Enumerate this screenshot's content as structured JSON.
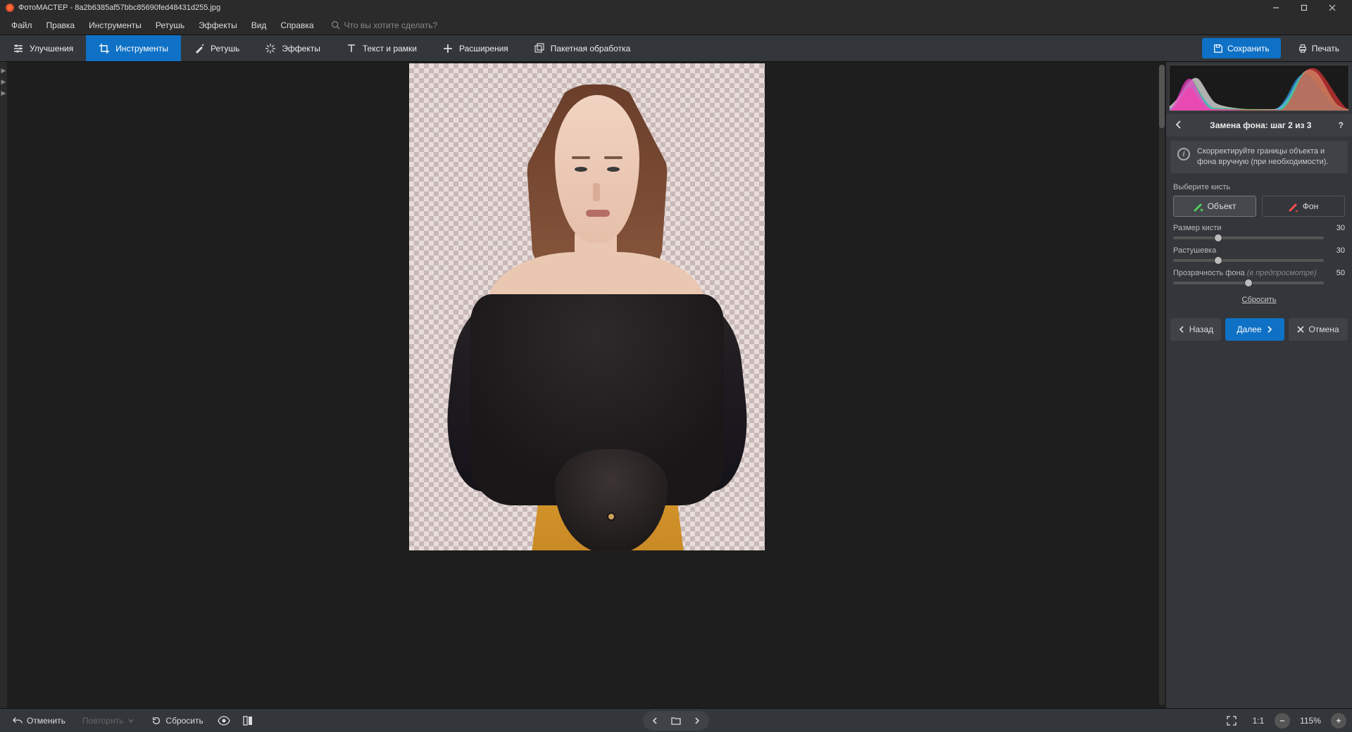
{
  "titlebar": {
    "app_name": "ФотоМАСТЕР",
    "file_name": "8a2b6385af57bbc85690fed48431d255.jpg"
  },
  "menubar": {
    "items": [
      "Файл",
      "Правка",
      "Инструменты",
      "Ретушь",
      "Эффекты",
      "Вид",
      "Справка"
    ],
    "search_placeholder": "Что вы хотите сделать?"
  },
  "toolbar": {
    "tabs": [
      {
        "label": "Улучшения",
        "icon": "sliders"
      },
      {
        "label": "Инструменты",
        "icon": "crop",
        "active": true
      },
      {
        "label": "Ретушь",
        "icon": "retouch"
      },
      {
        "label": "Эффекты",
        "icon": "sparkle"
      },
      {
        "label": "Текст и рамки",
        "icon": "text"
      },
      {
        "label": "Расширения",
        "icon": "plus"
      },
      {
        "label": "Пакетная обработка",
        "icon": "batch"
      }
    ],
    "save_label": "Сохранить",
    "print_label": "Печать"
  },
  "right_panel": {
    "title": "Замена фона: шаг 2 из 3",
    "info_text": "Скорректируйте границы объекта и фона вручную (при необходимости).",
    "brush_section_label": "Выберите кисть",
    "brush_object": "Объект",
    "brush_background": "Фон",
    "sliders": {
      "size_label": "Размер кисти",
      "size_value": "30",
      "feather_label": "Растушевка",
      "feather_value": "30",
      "opacity_label": "Прозрачность фона",
      "opacity_hint": "(в предпросмотре)",
      "opacity_value": "50"
    },
    "reset_label": "Сбросить",
    "nav_back": "Назад",
    "nav_next": "Далее",
    "nav_cancel": "Отмена"
  },
  "bottombar": {
    "undo": "Отменить",
    "redo": "Повторить",
    "reset": "Сбросить",
    "zoom_ratio": "1:1",
    "zoom_value": "115%"
  }
}
